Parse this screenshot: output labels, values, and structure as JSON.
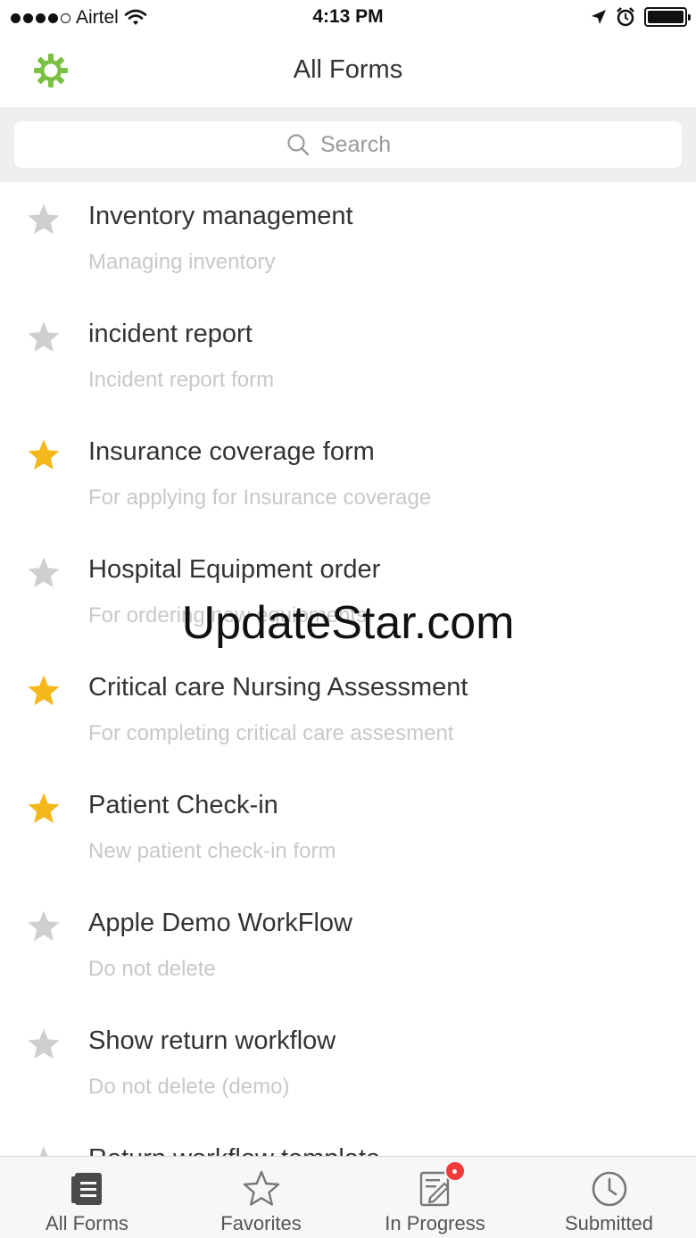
{
  "status_bar": {
    "carrier": "Airtel",
    "time": "4:13 PM"
  },
  "header": {
    "title": "All Forms",
    "settings_icon": "gear-icon"
  },
  "search": {
    "placeholder": "Search"
  },
  "colors": {
    "accent": "#7ac143",
    "star_active": "#f5b81c",
    "star_inactive": "#cfcfcf",
    "badge": "#ef3b3b"
  },
  "forms": [
    {
      "title": "Inventory management",
      "subtitle": "Managing inventory",
      "favorite": false
    },
    {
      "title": "incident report",
      "subtitle": "Incident report form",
      "favorite": false
    },
    {
      "title": "Insurance coverage form",
      "subtitle": "For applying for Insurance coverage",
      "favorite": true
    },
    {
      "title": "Hospital Equipment order",
      "subtitle": "For ordering new equipments",
      "favorite": false
    },
    {
      "title": "Critical care Nursing Assessment",
      "subtitle": "For completing critical care assesment",
      "favorite": true
    },
    {
      "title": "Patient Check-in",
      "subtitle": "New patient check-in form",
      "favorite": true
    },
    {
      "title": "Apple Demo WorkFlow",
      "subtitle": "Do not delete",
      "favorite": false
    },
    {
      "title": "Show return workflow",
      "subtitle": "Do not delete (demo)",
      "favorite": false
    },
    {
      "title": "Return workflow template",
      "subtitle": "",
      "favorite": false
    }
  ],
  "watermark": "UpdateStar.com",
  "tabs": [
    {
      "label": "All Forms",
      "icon": "forms-icon"
    },
    {
      "label": "Favorites",
      "icon": "star-icon"
    },
    {
      "label": "In Progress",
      "icon": "edit-document-icon"
    },
    {
      "label": "Submitted",
      "icon": "clock-icon"
    }
  ]
}
